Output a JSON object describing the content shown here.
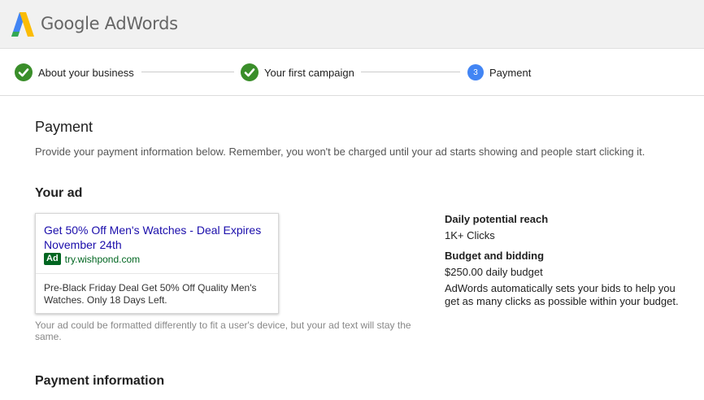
{
  "header": {
    "brand_google": "Google",
    "brand_product": "AdWords"
  },
  "stepper": {
    "steps": [
      {
        "label": "About your business",
        "status": "complete"
      },
      {
        "label": "Your first campaign",
        "status": "complete"
      },
      {
        "label": "Payment",
        "status": "current",
        "number": "3"
      }
    ]
  },
  "page": {
    "title": "Payment",
    "description": "Provide your payment information below. Remember, you won't be charged until your ad starts showing and people start clicking it."
  },
  "your_ad": {
    "section_title": "Your ad",
    "headline": "Get 50% Off Men's Watches - Deal Expires November 24th",
    "badge": "Ad",
    "display_url": "try.wishpond.com",
    "description": "Pre-Black Friday Deal Get 50% Off Quality Men's Watches. Only 18 Days Left.",
    "note": "Your ad could be formatted differently to fit a user's device, but your ad text will stay the same."
  },
  "reach": {
    "daily_reach_heading": "Daily potential reach",
    "daily_reach_value": "1K+ Clicks",
    "budget_heading": "Budget and bidding",
    "budget_value": "$250.00 daily budget",
    "budget_note": "AdWords automatically sets your bids to help you get as many clicks as possible within your budget."
  },
  "payment_info": {
    "section_title": "Payment information"
  },
  "colors": {
    "check_green": "#3a8e2a",
    "step_blue": "#4285f4",
    "ad_link": "#1a0dab",
    "ad_green": "#006621"
  }
}
